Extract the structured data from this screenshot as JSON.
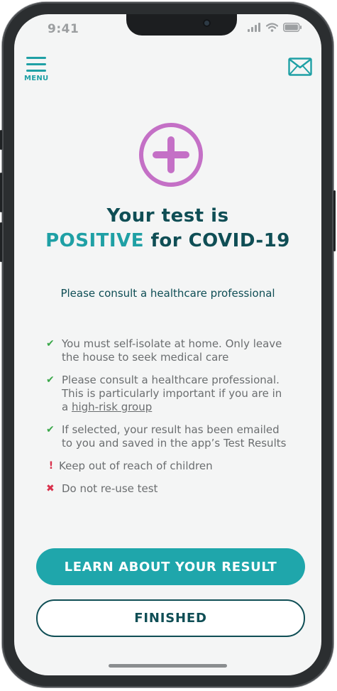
{
  "status_bar": {
    "time": "9:41"
  },
  "header": {
    "menu_label": "MENU"
  },
  "result": {
    "line1": "Your test is",
    "positive": "POSITIVE",
    "line2_rest": " for COVID-19",
    "subtitle": "Please consult a healthcare professional"
  },
  "instructions": [
    {
      "type": "check",
      "text": "You must self-isolate at home. Only leave the house to seek medical care"
    },
    {
      "type": "check",
      "text_before": "Please consult a healthcare professional. This is particularly important if you are in a ",
      "link": "high-risk group"
    },
    {
      "type": "check",
      "text": "If selected, your result has been emailed to you and saved in the app’s Test Results"
    },
    {
      "type": "warning",
      "text": "Keep out of reach of children"
    },
    {
      "type": "cross",
      "text": "Do not re-use test"
    }
  ],
  "buttons": {
    "learn": "LEARN ABOUT YOUR RESULT",
    "finished": "FINISHED"
  },
  "colors": {
    "accent_teal": "#1fa6ab",
    "dark_teal": "#0f4e55",
    "positive_purple": "#c470c6",
    "check_green": "#3aa84a",
    "alert_red": "#d9314c"
  }
}
